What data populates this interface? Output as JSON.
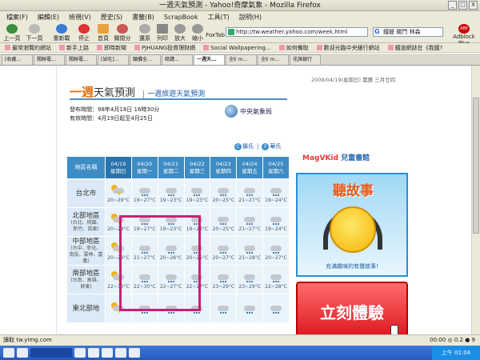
{
  "window": {
    "title": "一週天氣預測 - Yahoo!奇摩氣象 - Mozilla Firefox",
    "min": "_",
    "max": "□",
    "close": "X"
  },
  "menu": [
    "檔案(F)",
    "編輯(E)",
    "檢視(V)",
    "歷史(S)",
    "書籤(B)",
    "ScrapBook",
    "工具(T)",
    "說明(H)"
  ],
  "toolbar": {
    "back": "上一頁",
    "forward": "下一頁",
    "reload": "重新載入",
    "stop": "停止",
    "home": "首頁",
    "close_tab": "關閉分頁",
    "undo": "還原",
    "print": "列印",
    "zoom_in": "放大",
    "zoom_out": "縮小",
    "foxtab": "FoxTab"
  },
  "address": {
    "url": "http://tw.weather.yahoo.com/week.html"
  },
  "search": {
    "engine": "G",
    "text": "鐵嬤 關門 林森"
  },
  "adblock": {
    "icon": "ABP",
    "label": "Adblock Plus"
  },
  "bookmarks": [
    "最常瀏覽的網站",
    "新手上路",
    "即時新聞",
    "PJHUANG投資理財網",
    "Social Wallpapering...",
    "如何備取",
    "歡迎光臨中央銀行網站",
    "鐵道網誌在《我國?"
  ],
  "tabs": [
    "[收藏...",
    "關聯電...",
    "關聯電...",
    "[試吃]...",
    "麵攤全...",
    "暗講...",
    "一週天...",
    "全E m...",
    "全E m...",
    "花旗銀行"
  ],
  "active_tab": 6,
  "page": {
    "date": "2009/04/19(星期日) 農曆 三月廿四",
    "title_accent": "一週",
    "title_rest": "天氣預測",
    "travel_link": "一週旅遊天氣預測",
    "issued": "發布時間：98年4月18日 16時30分",
    "valid": "有效時間：4月19日起至4月25日",
    "cwb_name": "中央氣象局",
    "unit_c": "攝氏",
    "unit_f": "華氏",
    "unit_c_icon": "C",
    "unit_f_icon": "F",
    "region_header": "地區名稱",
    "days": [
      {
        "date": "04/19",
        "wd": "星期日"
      },
      {
        "date": "04/20",
        "wd": "星期一"
      },
      {
        "date": "04/21",
        "wd": "星期二"
      },
      {
        "date": "04/22",
        "wd": "星期三"
      },
      {
        "date": "04/23",
        "wd": "星期四"
      },
      {
        "date": "04/24",
        "wd": "星期五"
      },
      {
        "date": "04/25",
        "wd": "星期六"
      }
    ],
    "rows": [
      {
        "name": "台北市",
        "sub": "",
        "temps": [
          "20~29°C",
          "19~27°C",
          "19~23°C",
          "19~23°C",
          "20~25°C",
          "21~27°C",
          "19~24°C"
        ]
      },
      {
        "name": "北部地區",
        "sub": "(台北、桃園、新竹、苗栗)",
        "temps": [
          "20~29°C",
          "19~27°C",
          "19~23°C",
          "19~23°C",
          "20~25°C",
          "21~27°C",
          "19~24°C"
        ]
      },
      {
        "name": "中部地區",
        "sub": "(台中、彰化、南投、雲林、嘉義)",
        "temps": [
          "20~29°C",
          "21~27°C",
          "20~26°C",
          "20~25°C",
          "20~27°C",
          "21~28°C",
          "20~27°C"
        ]
      },
      {
        "name": "南部地區",
        "sub": "(台南、高雄、屏東)",
        "temps": [
          "22~30°C",
          "22~30°C",
          "22~27°C",
          "22~27°C",
          "23~29°C",
          "23~29°C",
          "22~28°C"
        ]
      },
      {
        "name": "東北部地",
        "sub": "",
        "temps": [
          "",
          "",
          "",
          "",
          "",
          "",
          ""
        ]
      }
    ]
  },
  "ad": {
    "brand_a": "MagV",
    "brand_b": "Kid",
    "brand_c": "兒童書館",
    "big": "聽故事",
    "sub": "充滿趣味的有聲故事!",
    "cta": "立刻體驗"
  },
  "status": {
    "text": "讀取 tw.yimg.com",
    "right": "00:00 ◎ 0.2 ● 9"
  },
  "taskbar": {
    "clock": "上午 01:04"
  }
}
